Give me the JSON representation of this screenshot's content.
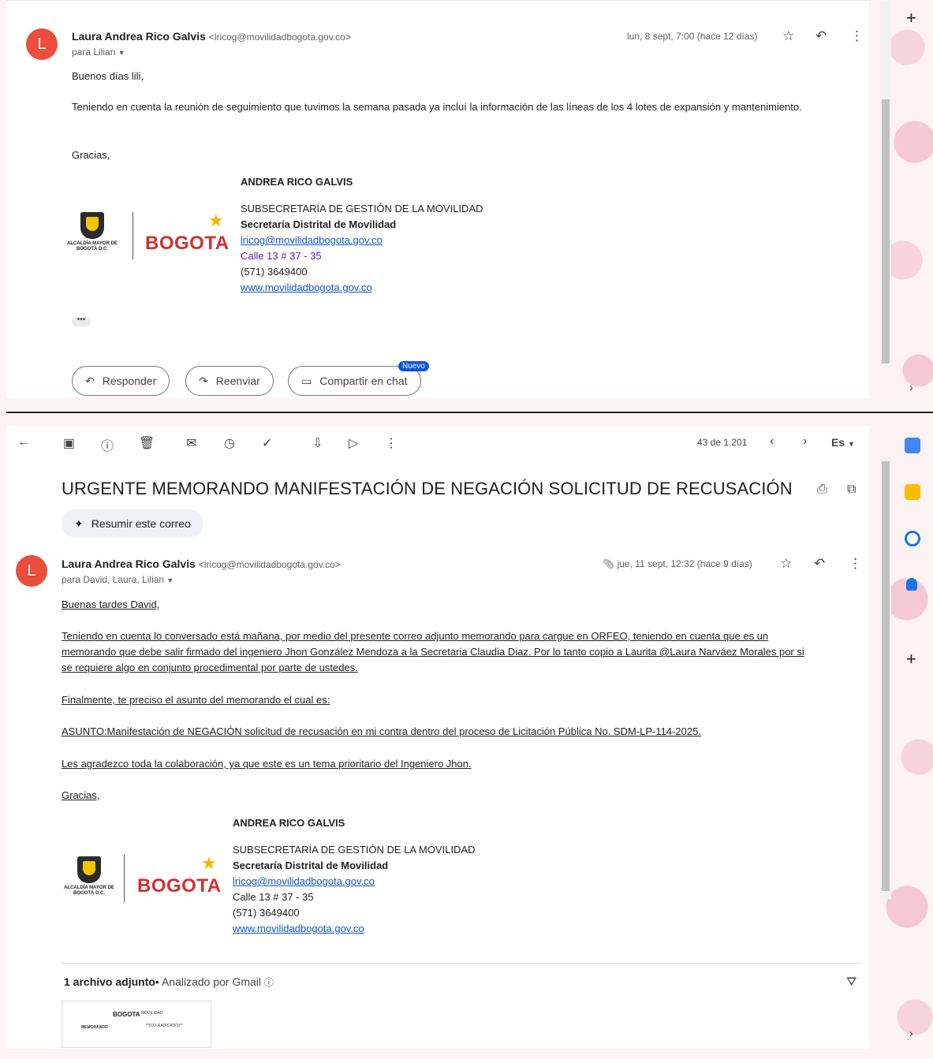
{
  "thread_previous": {
    "avatar_letter": "L",
    "sender_name": "Laura Andrea Rico Galvis",
    "sender_email": "<lricog@movilidadbogota.gov.co>",
    "to": "para Lilian",
    "date": "lun, 8 sept, 7:00 (hace 12 días)",
    "greeting": "Buenos días lili,",
    "paragraph": "Teniendo en cuenta la reunión de seguimiento que tuvimos la semana pasada ya incluí la información de las líneas de los 4 lotes de expansión y mantenimiento.",
    "closing": "Gracias,",
    "ellipsis": "•••",
    "reply_label": "Responder",
    "forward_label": "Reenviar",
    "share_chat_label": "Compartir en chat",
    "new_badge": "Nuevo"
  },
  "signature": {
    "name": "ANDREA RICO GALVIS",
    "dept": "SUBSECRETARÍA DE GESTIÓN DE LA MOVILIDAD",
    "org": "Secretaría Distrital de Movilidad",
    "email": "lricog@movilidadbogota.gov.co",
    "address": "Calle 13 # 37 - 35",
    "phone": "(571) 3649400",
    "web": "www.movilidadbogota.gov.co",
    "logo_small": "ALCALDÍA MAYOR DE BOGOTÁ D.C.",
    "logo_brand": "BOGOTA"
  },
  "toolbar": {
    "counter": "43 de 1.201",
    "language": "Es"
  },
  "message": {
    "subject": "URGENTE MEMORANDO MANIFESTACIÓN DE NEGACIÓN SOLICITUD DE RECUSACIÓN",
    "summary_label": "Resumir este correo",
    "avatar_letter": "L",
    "sender_name": "Laura Andrea Rico Galvis",
    "sender_email": "<lricog@movilidadbogota.gov.co>",
    "to": "para David, Laura, Lilian",
    "date": "jue, 11 sept, 12:32 (hace 9 días)",
    "lines": [
      "Buenas tardes David,",
      "Teniendo en cuenta lo conversado está mañana, por medio del presente correo adjunto memorando para cargue en ORFEO, teniendo en cuenta que es un",
      "memorando que debe salir firmado del ingeniero Jhon González Mendoza a la Secretaria Claudia Diaz. Por lo tanto copio a Laurita @Laura Narváez Morales por si",
      "se requiere algo en conjunto procedimental por parte de ustedes.",
      "Finalmente, te preciso el asunto del memorando el cual es:",
      "ASUNTO:Manifestación de NEGACIÓN solicitud de recusación en mi contra dentro del proceso de Licitación Pública No. SDM-LP-114-2025.",
      "Les agradezco toda la colaboración, ya que este es un tema prioritario del Ingeniero Jhon.",
      "Gracias,"
    ],
    "attachments_count": "1 archivo adjunto",
    "scanned_label": "Analizado por Gmail",
    "thumb_lines": [
      "MEMORANDO",
      "BOGOTA",
      "MOVILIDAD",
      "**(CO-RADICADO)**"
    ]
  },
  "icons": {
    "reply": "↶",
    "star": "☆",
    "more": "⋮",
    "plus": "+"
  },
  "colors": {
    "avatar": "#ea4e3d",
    "link": "#1a0dab",
    "accent": "#0b57d0",
    "brand_red": "#d62e2e"
  }
}
